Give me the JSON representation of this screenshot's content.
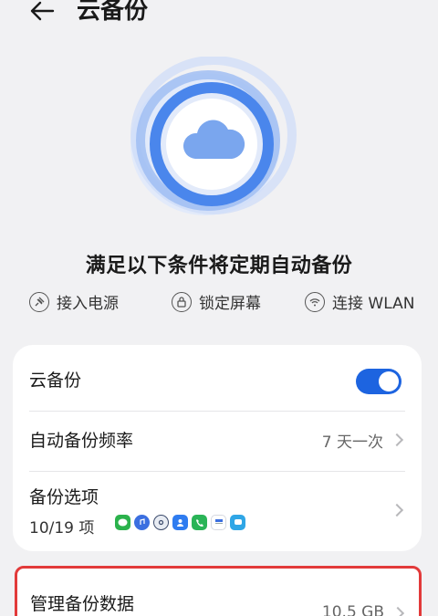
{
  "header": {
    "title": "云备份"
  },
  "hero": {
    "headline": "满足以下条件将定期自动备份"
  },
  "conditions": [
    {
      "label": "接入电源",
      "icon": "power-plug-icon"
    },
    {
      "label": "锁定屏幕",
      "icon": "lock-icon"
    },
    {
      "label": "连接 WLAN",
      "icon": "wifi-icon"
    }
  ],
  "settings": {
    "cloud_backup": {
      "label": "云备份",
      "enabled": true
    },
    "frequency": {
      "label": "自动备份频率",
      "value": "7 天一次"
    },
    "options": {
      "label": "备份选项",
      "count": "10/19 项"
    }
  },
  "manage": {
    "label": "管理备份数据",
    "value": "10.5 GB"
  },
  "colors": {
    "accent": "#1d64e0",
    "highlight_border": "#e23a3a",
    "background": "#f1f1f3"
  }
}
